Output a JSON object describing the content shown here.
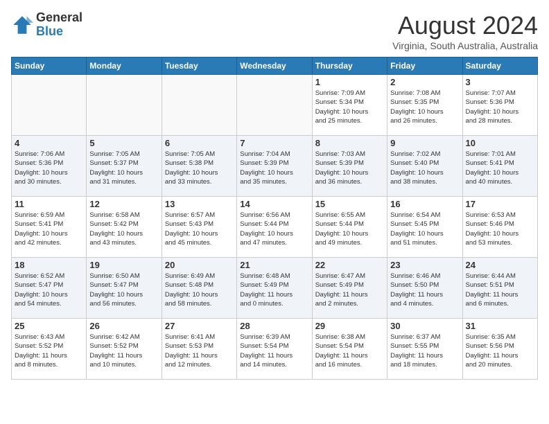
{
  "header": {
    "logo": {
      "general": "General",
      "blue": "Blue"
    },
    "title": "August 2024",
    "subtitle": "Virginia, South Australia, Australia"
  },
  "weekdays": [
    "Sunday",
    "Monday",
    "Tuesday",
    "Wednesday",
    "Thursday",
    "Friday",
    "Saturday"
  ],
  "weeks": [
    [
      {
        "day": "",
        "info": ""
      },
      {
        "day": "",
        "info": ""
      },
      {
        "day": "",
        "info": ""
      },
      {
        "day": "",
        "info": ""
      },
      {
        "day": "1",
        "info": "Sunrise: 7:09 AM\nSunset: 5:34 PM\nDaylight: 10 hours\nand 25 minutes."
      },
      {
        "day": "2",
        "info": "Sunrise: 7:08 AM\nSunset: 5:35 PM\nDaylight: 10 hours\nand 26 minutes."
      },
      {
        "day": "3",
        "info": "Sunrise: 7:07 AM\nSunset: 5:36 PM\nDaylight: 10 hours\nand 28 minutes."
      }
    ],
    [
      {
        "day": "4",
        "info": "Sunrise: 7:06 AM\nSunset: 5:36 PM\nDaylight: 10 hours\nand 30 minutes."
      },
      {
        "day": "5",
        "info": "Sunrise: 7:05 AM\nSunset: 5:37 PM\nDaylight: 10 hours\nand 31 minutes."
      },
      {
        "day": "6",
        "info": "Sunrise: 7:05 AM\nSunset: 5:38 PM\nDaylight: 10 hours\nand 33 minutes."
      },
      {
        "day": "7",
        "info": "Sunrise: 7:04 AM\nSunset: 5:39 PM\nDaylight: 10 hours\nand 35 minutes."
      },
      {
        "day": "8",
        "info": "Sunrise: 7:03 AM\nSunset: 5:39 PM\nDaylight: 10 hours\nand 36 minutes."
      },
      {
        "day": "9",
        "info": "Sunrise: 7:02 AM\nSunset: 5:40 PM\nDaylight: 10 hours\nand 38 minutes."
      },
      {
        "day": "10",
        "info": "Sunrise: 7:01 AM\nSunset: 5:41 PM\nDaylight: 10 hours\nand 40 minutes."
      }
    ],
    [
      {
        "day": "11",
        "info": "Sunrise: 6:59 AM\nSunset: 5:41 PM\nDaylight: 10 hours\nand 42 minutes."
      },
      {
        "day": "12",
        "info": "Sunrise: 6:58 AM\nSunset: 5:42 PM\nDaylight: 10 hours\nand 43 minutes."
      },
      {
        "day": "13",
        "info": "Sunrise: 6:57 AM\nSunset: 5:43 PM\nDaylight: 10 hours\nand 45 minutes."
      },
      {
        "day": "14",
        "info": "Sunrise: 6:56 AM\nSunset: 5:44 PM\nDaylight: 10 hours\nand 47 minutes."
      },
      {
        "day": "15",
        "info": "Sunrise: 6:55 AM\nSunset: 5:44 PM\nDaylight: 10 hours\nand 49 minutes."
      },
      {
        "day": "16",
        "info": "Sunrise: 6:54 AM\nSunset: 5:45 PM\nDaylight: 10 hours\nand 51 minutes."
      },
      {
        "day": "17",
        "info": "Sunrise: 6:53 AM\nSunset: 5:46 PM\nDaylight: 10 hours\nand 53 minutes."
      }
    ],
    [
      {
        "day": "18",
        "info": "Sunrise: 6:52 AM\nSunset: 5:47 PM\nDaylight: 10 hours\nand 54 minutes."
      },
      {
        "day": "19",
        "info": "Sunrise: 6:50 AM\nSunset: 5:47 PM\nDaylight: 10 hours\nand 56 minutes."
      },
      {
        "day": "20",
        "info": "Sunrise: 6:49 AM\nSunset: 5:48 PM\nDaylight: 10 hours\nand 58 minutes."
      },
      {
        "day": "21",
        "info": "Sunrise: 6:48 AM\nSunset: 5:49 PM\nDaylight: 11 hours\nand 0 minutes."
      },
      {
        "day": "22",
        "info": "Sunrise: 6:47 AM\nSunset: 5:49 PM\nDaylight: 11 hours\nand 2 minutes."
      },
      {
        "day": "23",
        "info": "Sunrise: 6:46 AM\nSunset: 5:50 PM\nDaylight: 11 hours\nand 4 minutes."
      },
      {
        "day": "24",
        "info": "Sunrise: 6:44 AM\nSunset: 5:51 PM\nDaylight: 11 hours\nand 6 minutes."
      }
    ],
    [
      {
        "day": "25",
        "info": "Sunrise: 6:43 AM\nSunset: 5:52 PM\nDaylight: 11 hours\nand 8 minutes."
      },
      {
        "day": "26",
        "info": "Sunrise: 6:42 AM\nSunset: 5:52 PM\nDaylight: 11 hours\nand 10 minutes."
      },
      {
        "day": "27",
        "info": "Sunrise: 6:41 AM\nSunset: 5:53 PM\nDaylight: 11 hours\nand 12 minutes."
      },
      {
        "day": "28",
        "info": "Sunrise: 6:39 AM\nSunset: 5:54 PM\nDaylight: 11 hours\nand 14 minutes."
      },
      {
        "day": "29",
        "info": "Sunrise: 6:38 AM\nSunset: 5:54 PM\nDaylight: 11 hours\nand 16 minutes."
      },
      {
        "day": "30",
        "info": "Sunrise: 6:37 AM\nSunset: 5:55 PM\nDaylight: 11 hours\nand 18 minutes."
      },
      {
        "day": "31",
        "info": "Sunrise: 6:35 AM\nSunset: 5:56 PM\nDaylight: 11 hours\nand 20 minutes."
      }
    ]
  ]
}
